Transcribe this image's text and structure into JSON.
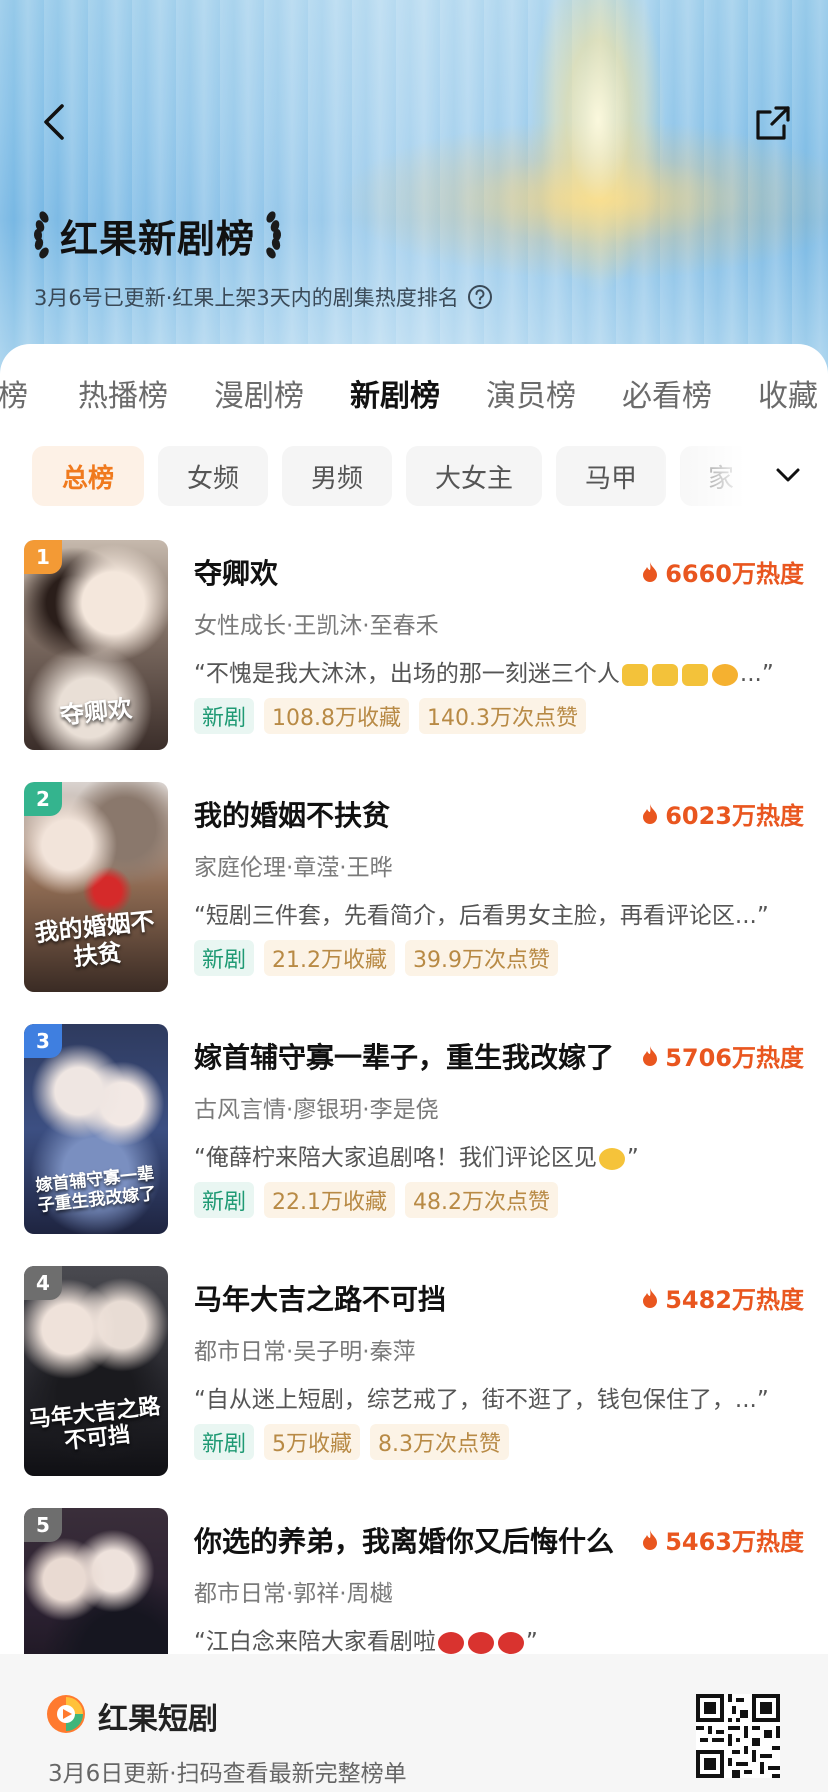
{
  "header": {
    "title": "红果新剧榜",
    "subtitle": "3月6号已更新·红果上架3天内的剧集热度排名",
    "back_icon": "chevron-left-icon",
    "share_icon": "share-icon",
    "help_icon": "question-circle-icon"
  },
  "tabs": [
    {
      "label": "榜"
    },
    {
      "label": "热播榜"
    },
    {
      "label": "漫剧榜"
    },
    {
      "label": "新剧榜",
      "active": true
    },
    {
      "label": "演员榜"
    },
    {
      "label": "必看榜"
    },
    {
      "label": "收藏"
    }
  ],
  "filters": [
    {
      "label": "总榜",
      "active": true
    },
    {
      "label": "女频"
    },
    {
      "label": "男频"
    },
    {
      "label": "大女主"
    },
    {
      "label": "马甲"
    },
    {
      "label": "家"
    }
  ],
  "filters_expand_icon": "chevron-down-icon",
  "list": [
    {
      "rank": "1",
      "title": "夺卿欢",
      "heat": "6660万热度",
      "meta": "女性成长·王凯沐·至春禾",
      "quote_start": "“不愧是我大沐沐，出场的那一刻迷三个人",
      "quote_end": "...”",
      "tags": [
        "新剧",
        "108.8万收藏",
        "140.3万次点赞"
      ],
      "cover_title": "夺卿欢"
    },
    {
      "rank": "2",
      "title": "我的婚姻不扶贫",
      "heat": "6023万热度",
      "meta": "家庭伦理·章滢·王晔",
      "quote_start": "“短剧三件套，先看简介，后看男女主脸，再看评论区...”",
      "quote_end": "",
      "tags": [
        "新剧",
        "21.2万收藏",
        "39.9万次点赞"
      ],
      "cover_title": "我的婚姻不扶贫"
    },
    {
      "rank": "3",
      "title": "嫁首辅守寡一辈子，重生我改嫁了",
      "heat": "5706万热度",
      "meta": "古风言情·廖银玥·李是侥",
      "quote_start": "“俺薛柠来陪大家追剧咯！我们评论区见",
      "quote_end": "”",
      "tags": [
        "新剧",
        "22.1万收藏",
        "48.2万次点赞"
      ],
      "cover_title": "嫁首辅守寡一辈子重生我改嫁了"
    },
    {
      "rank": "4",
      "title": "马年大吉之路不可挡",
      "heat": "5482万热度",
      "meta": "都市日常·吴子明·秦萍",
      "quote_start": "“自从迷上短剧，综艺戒了，街不逛了，钱包保住了，...”",
      "quote_end": "",
      "tags": [
        "新剧",
        "5万收藏",
        "8.3万次点赞"
      ],
      "cover_title": "马年大吉之路不可挡"
    },
    {
      "rank": "5",
      "title": "你选的养弟，我离婚你又后悔什么",
      "heat": "5463万热度",
      "meta": "都市日常·郭祥·周樾",
      "quote_start": "“江白念来陪大家看剧啦",
      "quote_end": "”",
      "tags": [],
      "cover_title": ""
    }
  ],
  "footer": {
    "brand": "红果短剧",
    "caption": "3月6日更新·扫码查看最新完整榜单",
    "qr_icon": "qr-code-icon"
  },
  "colors": {
    "accent_orange": "#f07a1e",
    "heat_red": "#e9561f",
    "rank_1": "#f39a35",
    "rank_2": "#34b48e",
    "rank_3": "#3f7fe0",
    "rank_other": "#6e6e6e",
    "tag_green": "#1f9a74",
    "tag_gold": "#b88a45"
  }
}
